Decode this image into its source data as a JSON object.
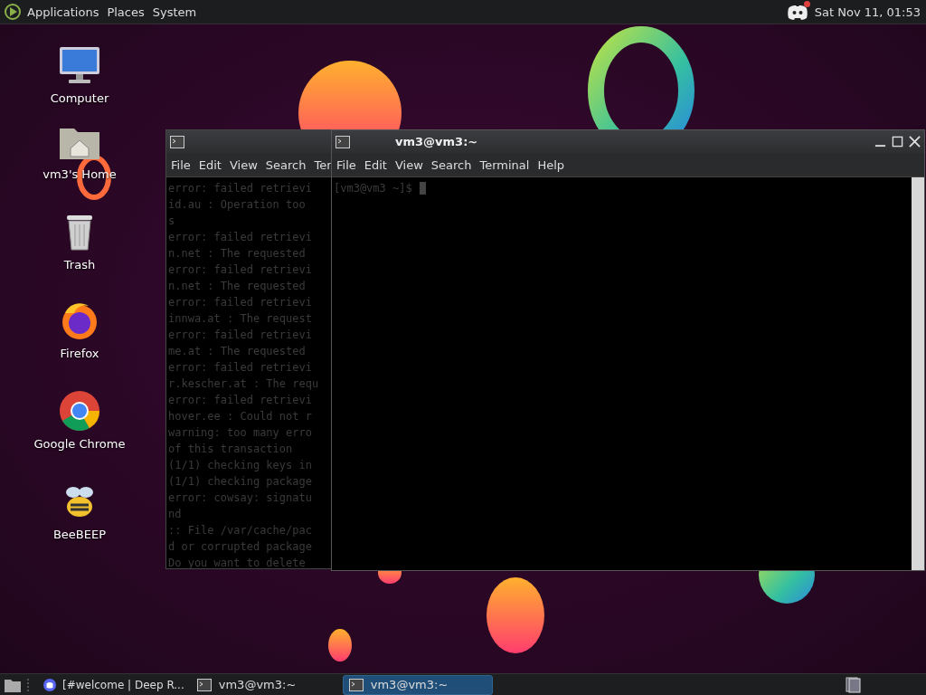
{
  "top_panel": {
    "menus": [
      "Applications",
      "Places",
      "System"
    ],
    "clock": "Sat Nov 11, 01:53",
    "notification": true
  },
  "desktop_icons": [
    {
      "kind": "computer",
      "label": "Computer"
    },
    {
      "kind": "home",
      "label": "vm3's Home"
    },
    {
      "kind": "trash",
      "label": "Trash"
    },
    {
      "kind": "firefox",
      "label": "Firefox"
    },
    {
      "kind": "chrome",
      "label": "Google Chrome"
    },
    {
      "kind": "bee",
      "label": "BeeBEEP"
    }
  ],
  "windows": [
    {
      "menus": [
        "File",
        "Edit",
        "View",
        "Search",
        "Ter"
      ],
      "lines": [
        "error: failed retrievi",
        "id.au : Operation too",
        "s",
        "error: failed retrievi",
        "n.net : The requested",
        "error: failed retrievi",
        "n.net : The requested",
        "error: failed retrievi",
        "innwa.at : The request",
        "error: failed retrievi",
        "me.at : The requested",
        "error: failed retrievi",
        "r.kescher.at : The requ",
        "error: failed retrievi",
        "hover.ee : Could not r",
        "warning: too many erro",
        "of this transaction",
        "(1/1) checking keys in",
        "(1/1) checking package",
        "error: cowsay: signatu",
        "nd",
        ":: File /var/cache/pac",
        "d or corrupted package",
        "Do you want to delete"
      ]
    },
    {
      "title": "vm3@vm3:~",
      "menus": [
        "File",
        "Edit",
        "View",
        "Search",
        "Terminal",
        "Help"
      ],
      "lines": [
        "[vm3@vm3 ~]$"
      ]
    }
  ],
  "taskbar": {
    "tasks": [
      {
        "kind": "discord",
        "label": "[#welcome | Deep R...",
        "selected": false
      },
      {
        "kind": "terminal",
        "label": "vm3@vm3:~",
        "selected": false
      },
      {
        "kind": "terminal",
        "label": "vm3@vm3:~",
        "selected": true
      }
    ]
  }
}
